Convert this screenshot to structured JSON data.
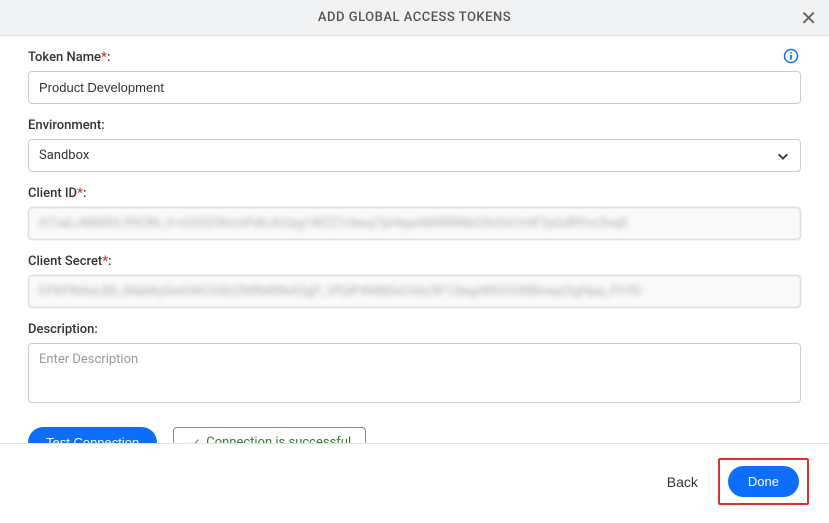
{
  "header": {
    "title": "ADD GLOBAL ACCESS TOKENS"
  },
  "form": {
    "tokenName": {
      "label": "Token Name",
      "required": "*",
      "colon": ":",
      "value": "Product Development"
    },
    "environment": {
      "label": "Environment:",
      "value": "Sandbox"
    },
    "clientId": {
      "label": "Client ID",
      "required": "*",
      "colon": ":",
      "value": "A7vaLcM60DLf9X3N_V-vOS5ZWxmPdhJlrUyg1WZZ1r6eoj7pHlypAM4R9NbO5x9zCmlF3yGdRYvc5vq0"
    },
    "clientSecret": {
      "label": "Client Secret",
      "required": "*",
      "colon": ":",
      "value": "EPKPNXuLB6_MabKyGw6WCGSUZNfN4l9kA0gP_VfQlP4WBGxUvbz5F12kqyW0GS5RBmqzOgHpq_FFrfD"
    },
    "description": {
      "label": "Description:",
      "placeholder": "Enter Description"
    }
  },
  "actions": {
    "testConnection": "Test Connection",
    "statusMessage": "Connection is successful"
  },
  "footer": {
    "back": "Back",
    "done": "Done"
  }
}
